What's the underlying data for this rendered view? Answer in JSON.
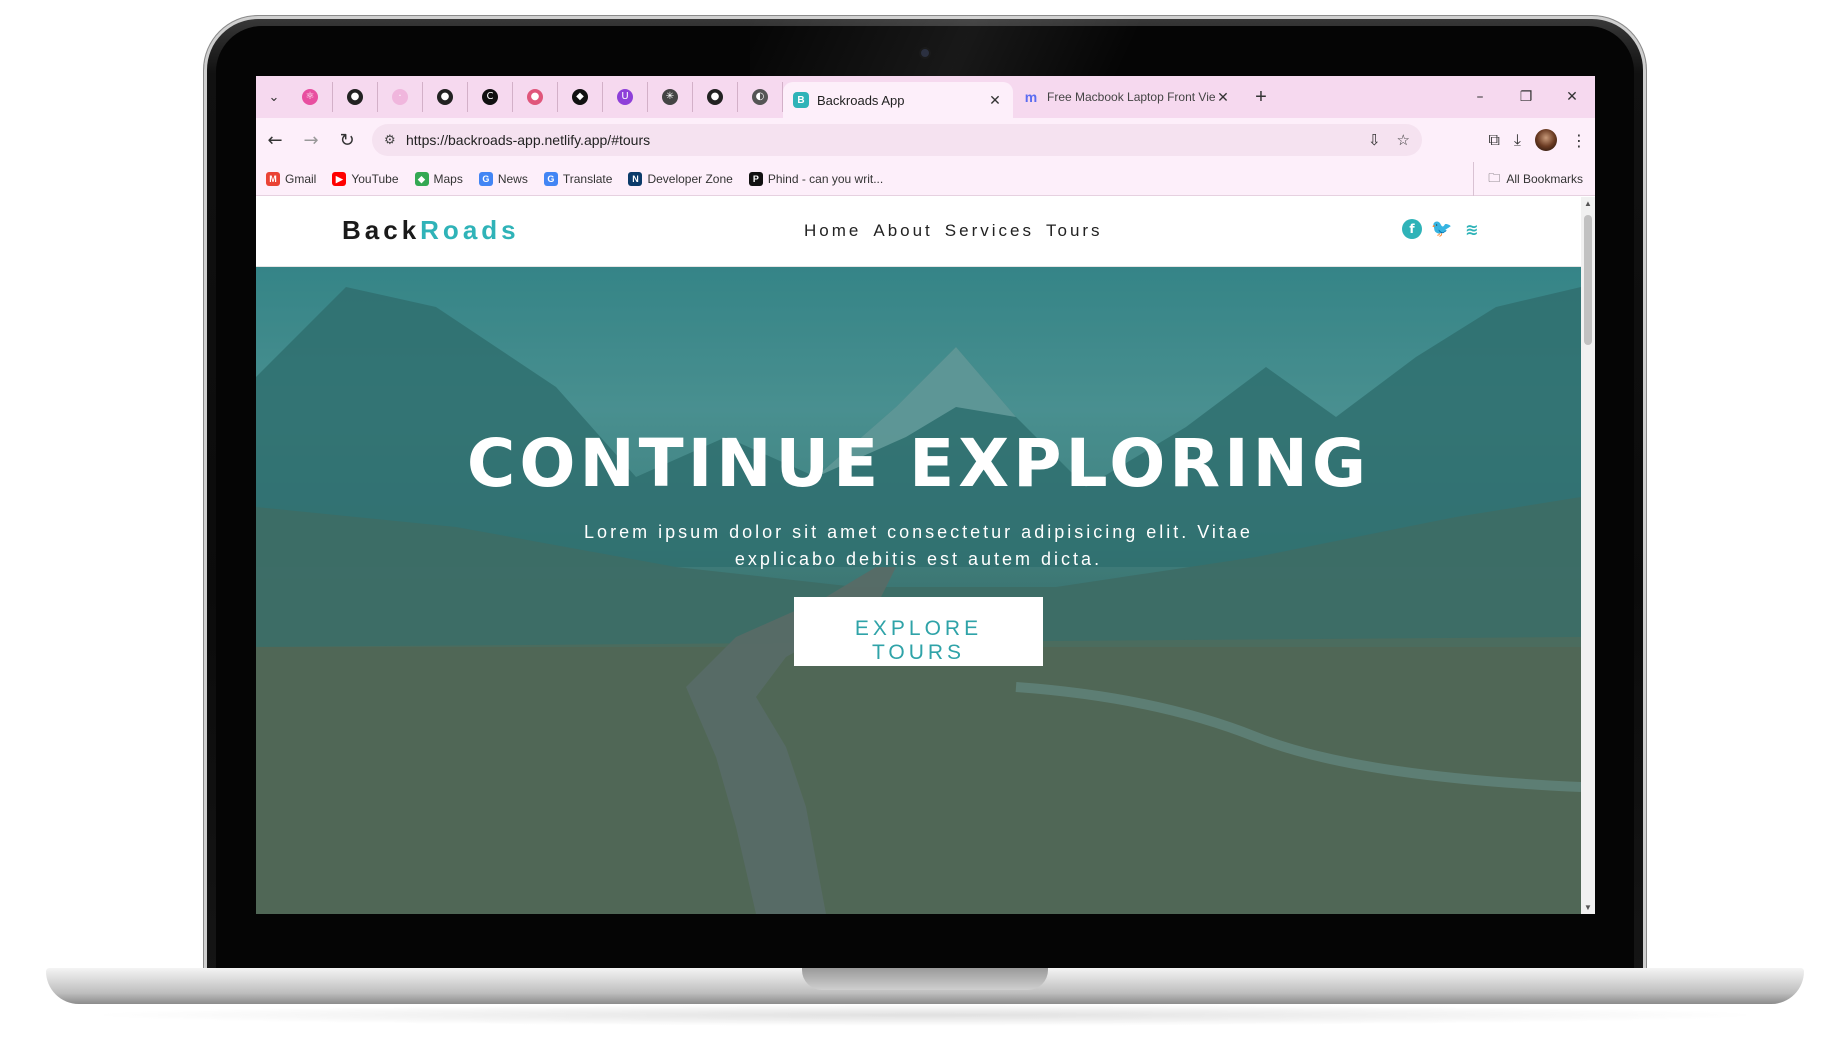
{
  "browser": {
    "pinned_tabs": [
      {
        "icon": "react-icon",
        "color": "#e84fa0",
        "glyph": "⚛"
      },
      {
        "icon": "github-icon",
        "color": "#222222",
        "glyph": "●"
      },
      {
        "icon": "tab-icon",
        "color": "#f0b6dd",
        "glyph": "·"
      },
      {
        "icon": "person-icon",
        "color": "#222222",
        "glyph": "●"
      },
      {
        "icon": "c-icon",
        "color": "#111111",
        "glyph": "C"
      },
      {
        "icon": "figma-icon",
        "color": "#e0567b",
        "glyph": "●"
      },
      {
        "icon": "codepen-icon",
        "color": "#111111",
        "glyph": "◆"
      },
      {
        "icon": "u-icon",
        "color": "#8e3fd9",
        "glyph": "U"
      },
      {
        "icon": "openai-icon",
        "color": "#444444",
        "glyph": "✳"
      },
      {
        "icon": "github-icon",
        "color": "#222222",
        "glyph": "●"
      },
      {
        "icon": "globe-icon",
        "color": "#555555",
        "glyph": "◐"
      }
    ],
    "active_tab": {
      "title": "Backroads App",
      "favicon": "B",
      "favicon_color": "#2fb3b8"
    },
    "inactive_tab": {
      "title": "Free Macbook Laptop Front Vie",
      "favicon": "m",
      "favicon_color": "#5b6cf0"
    },
    "url": "https://backroads-app.netlify.app/#tours",
    "bookmarks": [
      {
        "label": "Gmail",
        "icon": "gmail-icon",
        "color": "#ea4335",
        "glyph": "M"
      },
      {
        "label": "YouTube",
        "icon": "youtube-icon",
        "color": "#ff0000",
        "glyph": "▶"
      },
      {
        "label": "Maps",
        "icon": "maps-icon",
        "color": "#34a853",
        "glyph": "◆"
      },
      {
        "label": "News",
        "icon": "news-icon",
        "color": "#4285f4",
        "glyph": "G"
      },
      {
        "label": "Translate",
        "icon": "translate-icon",
        "color": "#4285f4",
        "glyph": "G"
      },
      {
        "label": "Developer Zone",
        "icon": "developer-zone-icon",
        "color": "#0b3b6a",
        "glyph": "N"
      },
      {
        "label": "Phind - can you writ...",
        "icon": "phind-icon",
        "color": "#111111",
        "glyph": "P"
      }
    ],
    "all_bookmarks": "All Bookmarks"
  },
  "site": {
    "logo_black": "Back",
    "logo_accent": "Roads",
    "nav": [
      "Home",
      "About",
      "Services",
      "Tours"
    ],
    "social": [
      "facebook-icon",
      "twitter-icon",
      "squarespace-icon"
    ],
    "accent_color": "#2fb3b8"
  },
  "hero": {
    "title": "CONTINUE EXPLORING",
    "subtitle": "Lorem ipsum dolor sit amet consectetur adipisicing elit. Vitae explicabo debitis est autem dicta.",
    "button": "EXPLORE TOURS"
  }
}
